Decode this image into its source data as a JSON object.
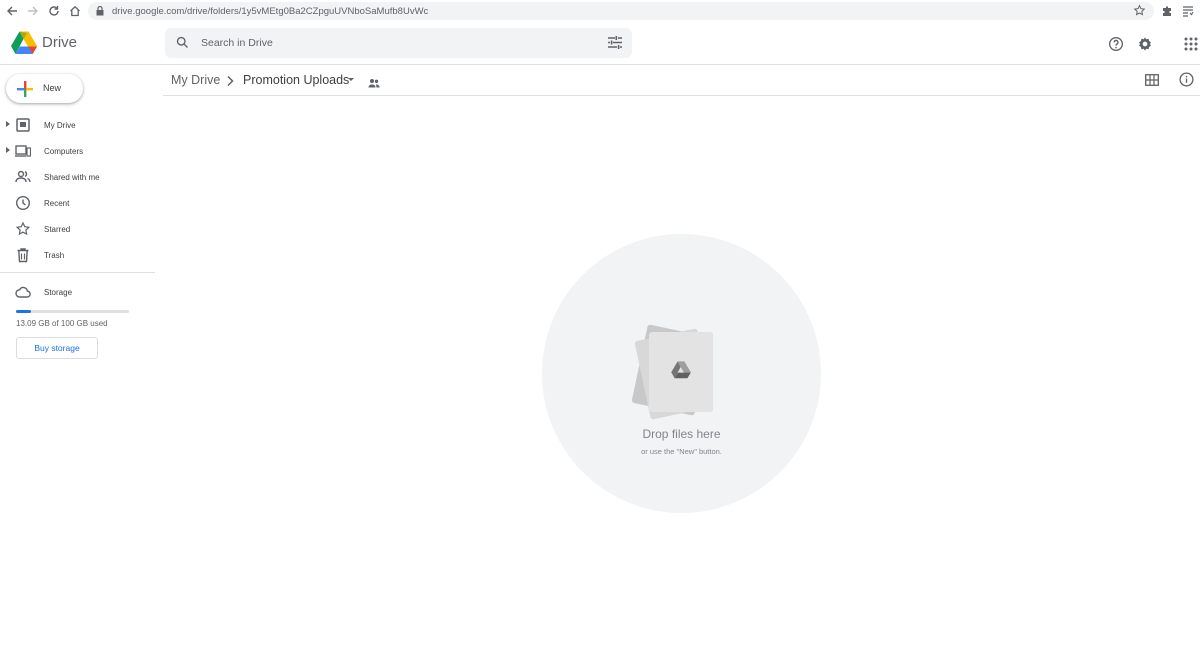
{
  "browser": {
    "url": "drive.google.com/drive/folders/1y5vMEtg0Ba2CZpguUVNboSaMufb8UvWc"
  },
  "app": {
    "name": "Drive",
    "search_placeholder": "Search in Drive"
  },
  "sidebar": {
    "new_label": "New",
    "items": [
      {
        "label": "My Drive",
        "icon": "my-drive-icon",
        "expandable": true
      },
      {
        "label": "Computers",
        "icon": "computers-icon",
        "expandable": true
      },
      {
        "label": "Shared with me",
        "icon": "shared-icon",
        "expandable": false
      },
      {
        "label": "Recent",
        "icon": "clock-icon",
        "expandable": false
      },
      {
        "label": "Starred",
        "icon": "star-icon",
        "expandable": false
      },
      {
        "label": "Trash",
        "icon": "trash-icon",
        "expandable": false
      }
    ],
    "storage": {
      "label": "Storage",
      "used_text": "13.09 GB of 100 GB used",
      "used_fraction": 0.1309,
      "buy_label": "Buy storage"
    }
  },
  "breadcrumb": {
    "root": "My Drive",
    "current": "Promotion Uploads"
  },
  "empty_state": {
    "title": "Drop files here",
    "subtitle": "or use the \"New\" button."
  },
  "colors": {
    "accent": "#1a73e8",
    "text": "#3c4043",
    "muted": "#5f6368"
  }
}
